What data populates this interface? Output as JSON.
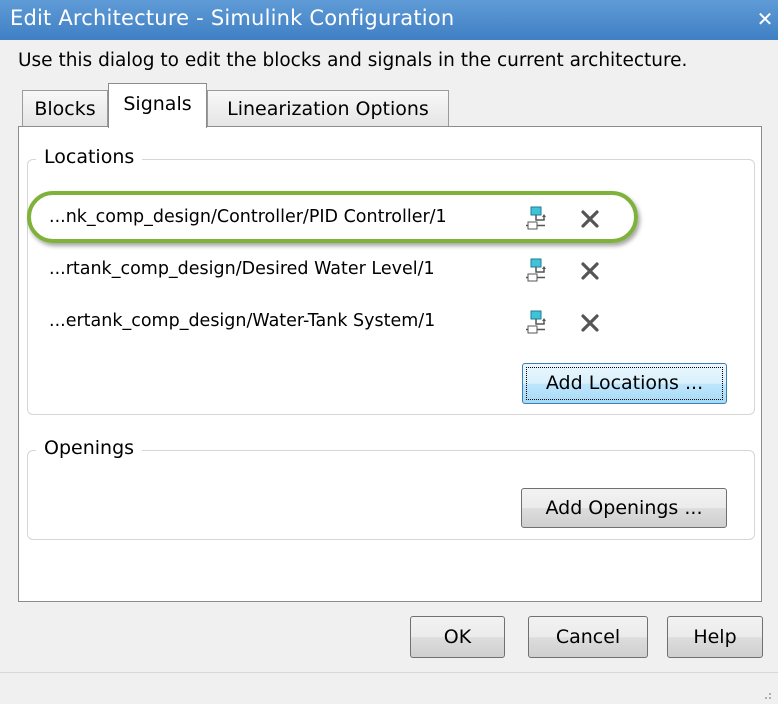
{
  "window": {
    "title": "Edit Architecture - Simulink Configuration",
    "close_glyph": "✕",
    "description": "Use this dialog to edit the blocks and signals in the current architecture."
  },
  "tabs": [
    {
      "label": "Blocks",
      "selected": false
    },
    {
      "label": "Signals",
      "selected": true
    },
    {
      "label": "Linearization Options",
      "selected": false
    }
  ],
  "locations": {
    "title": "Locations",
    "items": [
      {
        "path": "...nk_comp_design/Controller/PID Controller/1",
        "highlighted": true,
        "icon": "signal-selection-icon",
        "remove_icon": "delete-icon"
      },
      {
        "path": "...rtank_comp_design/Desired  Water Level/1",
        "highlighted": false,
        "icon": "signal-selection-icon",
        "remove_icon": "delete-icon"
      },
      {
        "path": "...ertank_comp_design/Water-Tank System/1",
        "highlighted": false,
        "icon": "signal-selection-icon",
        "remove_icon": "delete-icon"
      }
    ],
    "add_label": "Add Locations ..."
  },
  "openings": {
    "title": "Openings",
    "add_label": "Add Openings ..."
  },
  "footer": {
    "ok_label": "OK",
    "cancel_label": "Cancel",
    "help_label": "Help"
  },
  "colors": {
    "titlebar": "#4a8acb",
    "highlight": "#7fb23a",
    "focused_button": "#bee6fd"
  }
}
